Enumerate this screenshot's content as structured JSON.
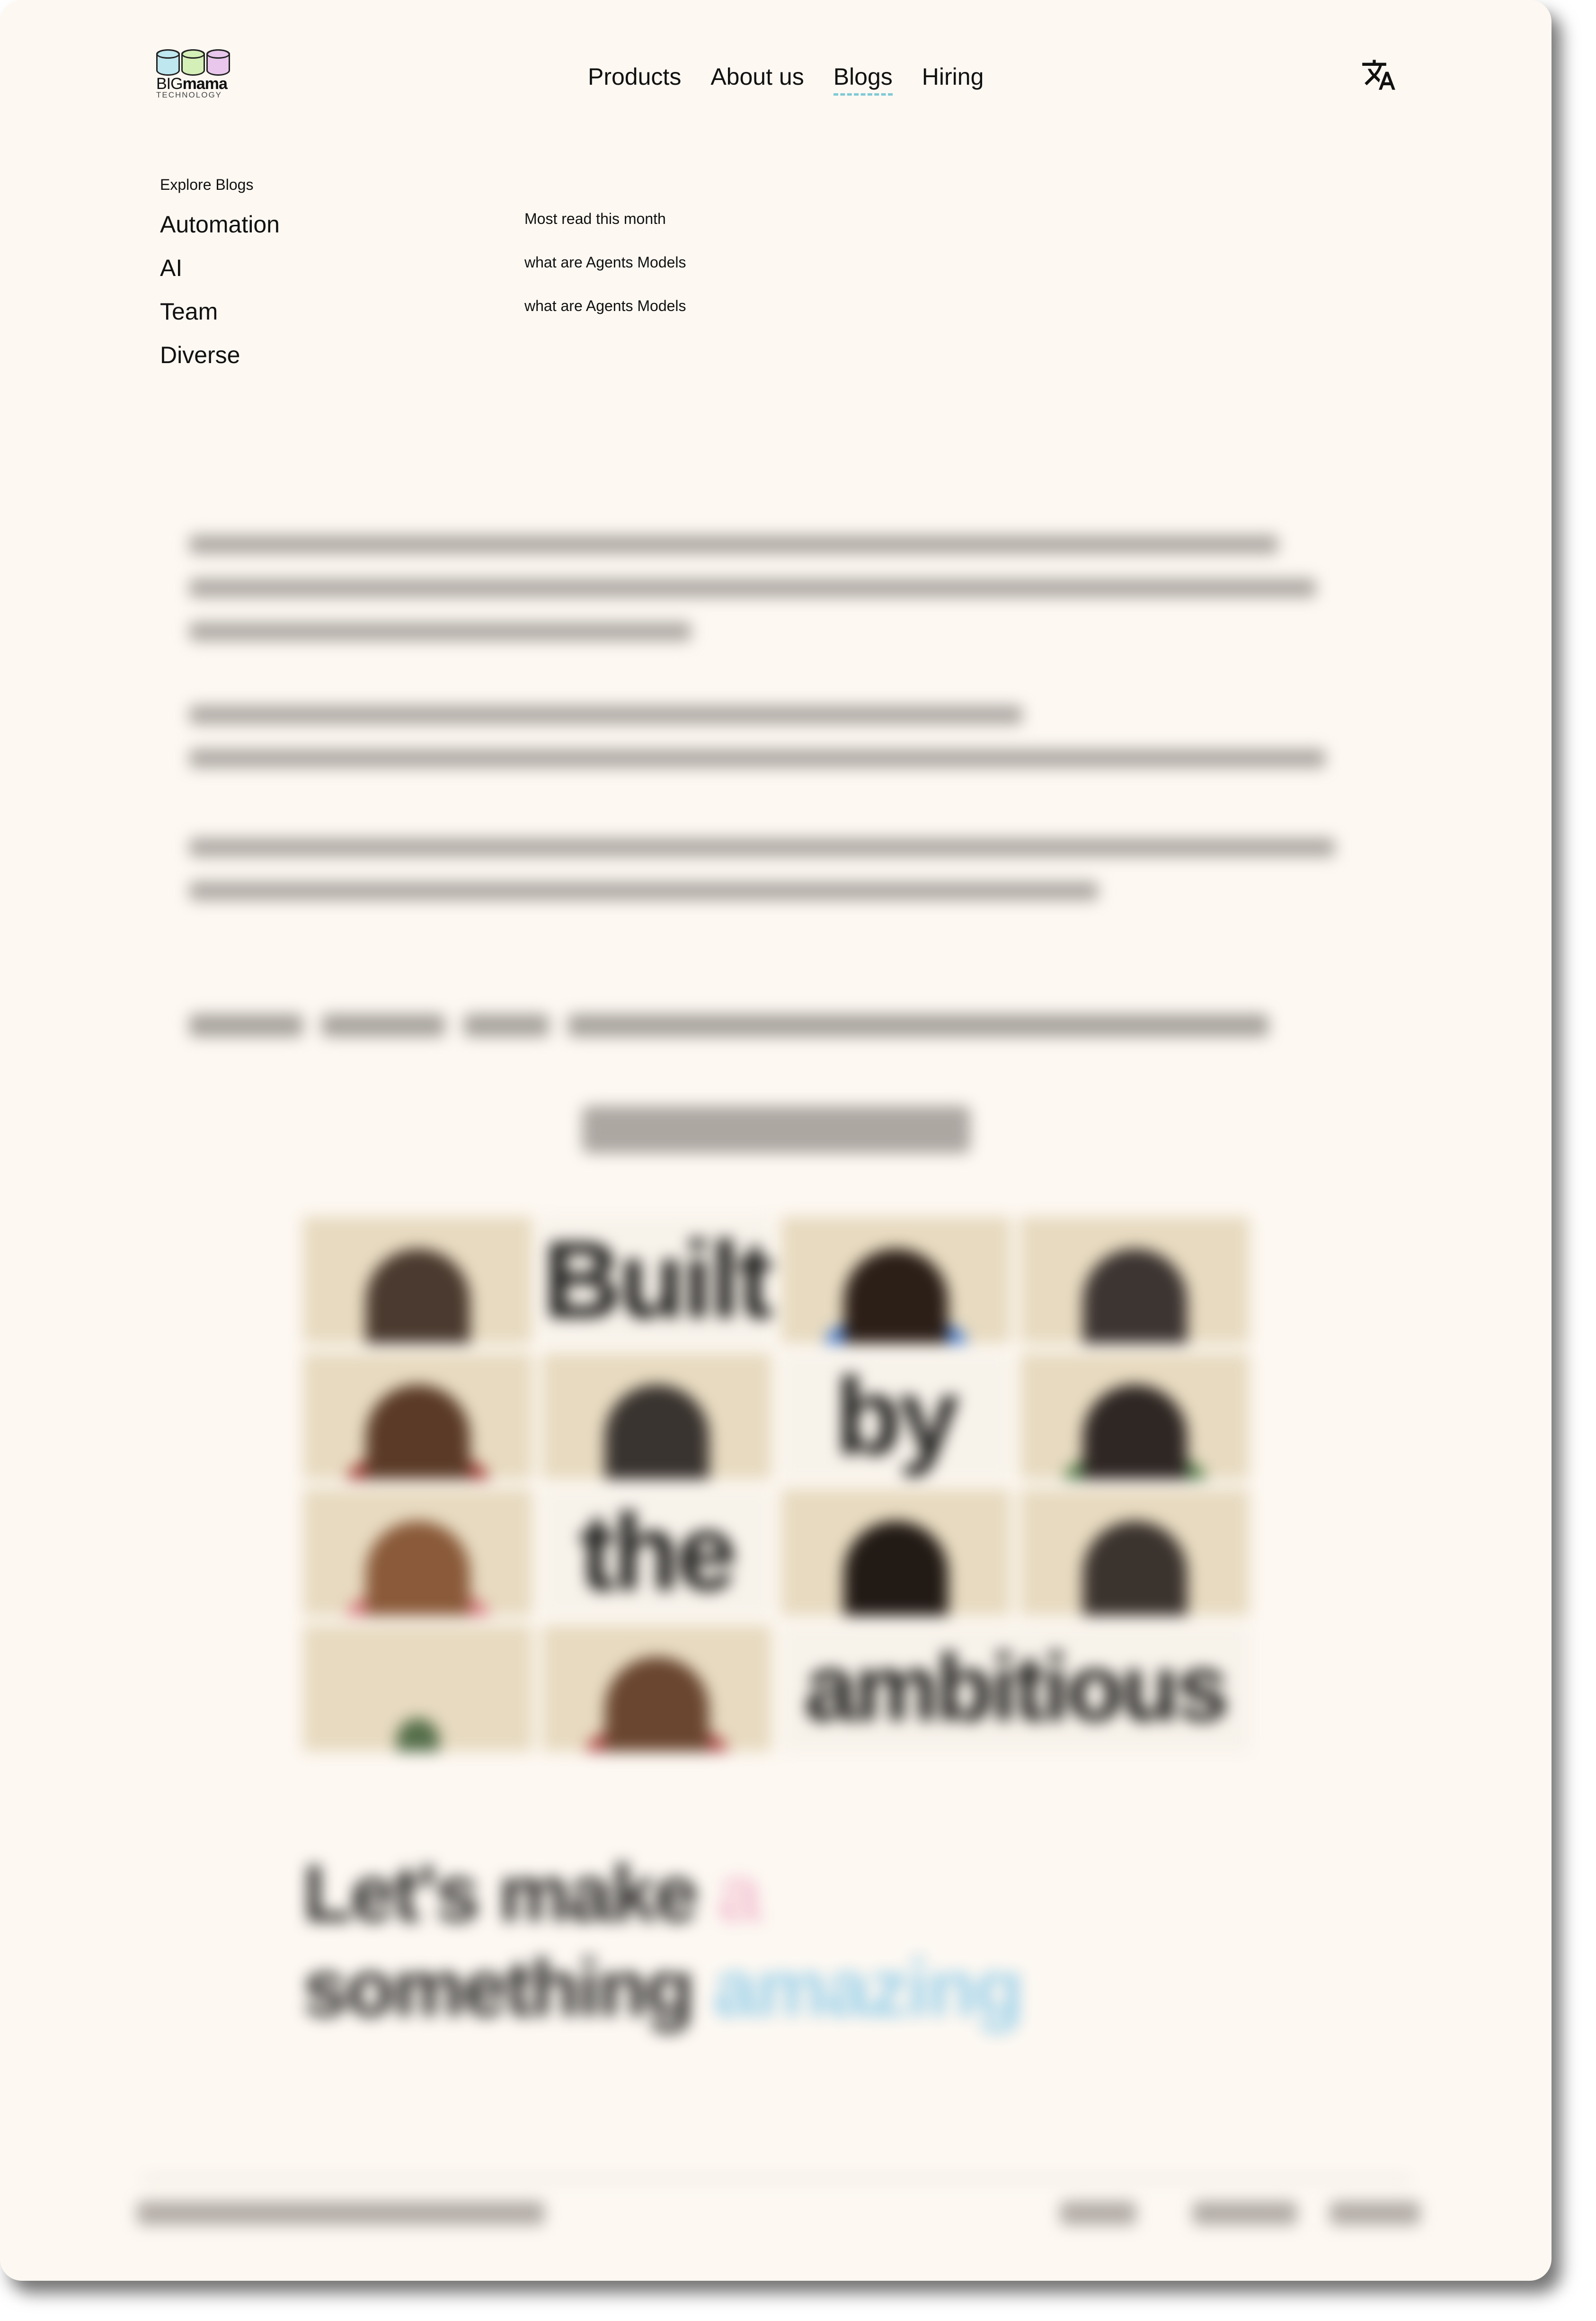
{
  "brand": {
    "name_light": "BIG",
    "name_bold": "mama",
    "tagline": "TECHNOLOGY",
    "drum_colors": [
      "#bfe7ef",
      "#d5efb8",
      "#e9c7ec"
    ]
  },
  "nav": {
    "items": [
      {
        "label": "Products",
        "active": false
      },
      {
        "label": "About us",
        "active": false
      },
      {
        "label": "Blogs",
        "active": true
      },
      {
        "label": "Hiring",
        "active": false
      }
    ],
    "language_icon": "translate-icon"
  },
  "blog_menu": {
    "title": "Explore Blogs",
    "categories": [
      "Automation",
      "AI",
      "Team",
      "Diverse"
    ],
    "most_read_title": "Most read this month",
    "most_read": [
      "what are Agents Models",
      "what are Agents Models"
    ]
  },
  "collage": {
    "words": [
      "Built",
      "by",
      "the",
      "ambitious"
    ],
    "accent_colors": [
      "#e7dac0",
      "#f7f2ea"
    ]
  },
  "cta": {
    "line1": "Let's make",
    "line1_accent": "a",
    "line2": "something",
    "line2_accent": "amazing",
    "accent_colors": [
      "#f3c4d4",
      "#9fd2ea"
    ]
  }
}
